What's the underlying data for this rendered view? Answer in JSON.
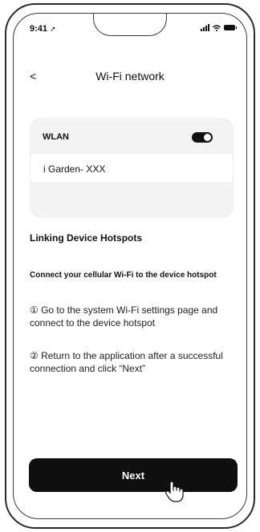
{
  "status_bar": {
    "time": "9:41"
  },
  "header": {
    "back_icon": "chevron-left-icon",
    "back_glyph": "<",
    "title": "Wi-Fi network"
  },
  "wlan": {
    "label": "WLAN",
    "toggle_on": true
  },
  "network": {
    "name": "i Garden- XXX"
  },
  "section": {
    "heading": "Linking Device Hotspots",
    "instruction": "Connect your cellular Wi-Fi to the device hotspot",
    "step1": "① Go to the system Wi-Fi settings page and connect to the device hotspot",
    "step2": "② Return to the application after a successful connection and click “Next”"
  },
  "footer": {
    "next_label": "Next"
  },
  "colors": {
    "button_bg": "#0f0f0f",
    "card_bg": "#f3f3f3"
  }
}
